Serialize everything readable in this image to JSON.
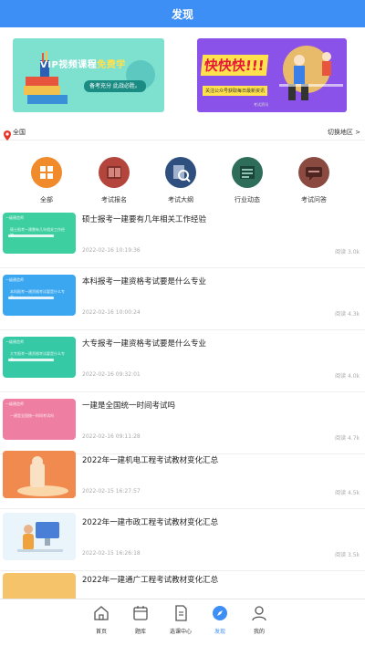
{
  "header": {
    "title": "发现"
  },
  "banners": [
    {
      "title_a": "VIP视频课程",
      "title_b": "免费学",
      "subtitle": "备考充分 此战必胜。"
    },
    {
      "title": "快快快!!!",
      "subtitle": "关注公众号获取每日最新资讯",
      "footer": "考试资讯"
    }
  ],
  "location": {
    "region": "全国",
    "switch_label": "切换地区 >"
  },
  "categories": [
    {
      "label": "全部",
      "color": "#f08a2a",
      "icon": "grid-icon"
    },
    {
      "label": "考试报名",
      "color": "#b3453d",
      "icon": "book-icon"
    },
    {
      "label": "考试大纲",
      "color": "#2f4f7e",
      "icon": "magnifier-document-icon"
    },
    {
      "label": "行业动态",
      "color": "#2d6d5a",
      "icon": "news-icon"
    },
    {
      "label": "考试问答",
      "color": "#8a4a40",
      "icon": "chat-icon"
    }
  ],
  "articles": [
    {
      "title": "硕士报考一建要有几年相关工作经验",
      "date": "2022-02-16 10:19:36",
      "views": "阅读 3.0k",
      "thumb_tag": "一级建造师",
      "thumb_lines": "硕士报考一建需有几年相关工作经验",
      "thumb_color": "#3ecfa0"
    },
    {
      "title": "本科报考一建资格考试要是什么专业",
      "date": "2022-02-16 10:00:24",
      "views": "阅读 4.3k",
      "thumb_tag": "一级建造师",
      "thumb_lines": "本科报考一建资格考试要是什么专业",
      "thumb_color": "#3aa7f0"
    },
    {
      "title": "大专报考一建资格考试要是什么专业",
      "date": "2022-02-16 09:32:01",
      "views": "阅读 4.0k",
      "thumb_tag": "一级建造师",
      "thumb_lines": "大专报考一建资格考试要是什么专业",
      "thumb_color": "#35c9a5"
    },
    {
      "title": "一建是全国统一时间考试吗",
      "date": "2022-02-16 09:11:28",
      "views": "阅读 4.7k",
      "thumb_tag": "一级建造师",
      "thumb_lines": "一建是全国统一时间考试吗",
      "thumb_color": "#ef7fa2"
    },
    {
      "title": "2022年一建机电工程考试教材变化汇总",
      "date": "2022-02-15 16:27:57",
      "views": "阅读 4.5k",
      "thumb_tag": "",
      "thumb_lines": "",
      "thumb_color": "#f5a15b"
    },
    {
      "title": "2022年一建市政工程考试教材变化汇总",
      "date": "2022-02-15 16:26:18",
      "views": "阅读 3.5k",
      "thumb_tag": "",
      "thumb_lines": "",
      "thumb_color": "#eef6fb"
    },
    {
      "title": "2022年一建通广工程考试教材变化汇总",
      "date": "",
      "views": "",
      "thumb_tag": "",
      "thumb_lines": "",
      "thumb_color": "#f5c46a"
    }
  ],
  "tabbar": {
    "tabs": [
      {
        "label": "首页",
        "icon": "home-icon"
      },
      {
        "label": "题库",
        "icon": "calendar-icon"
      },
      {
        "label": "选课中心",
        "icon": "document-icon"
      },
      {
        "label": "发现",
        "icon": "compass-icon"
      },
      {
        "label": "我的",
        "icon": "person-icon"
      }
    ],
    "active_index": 3,
    "active_color": "#3d8ff5"
  }
}
